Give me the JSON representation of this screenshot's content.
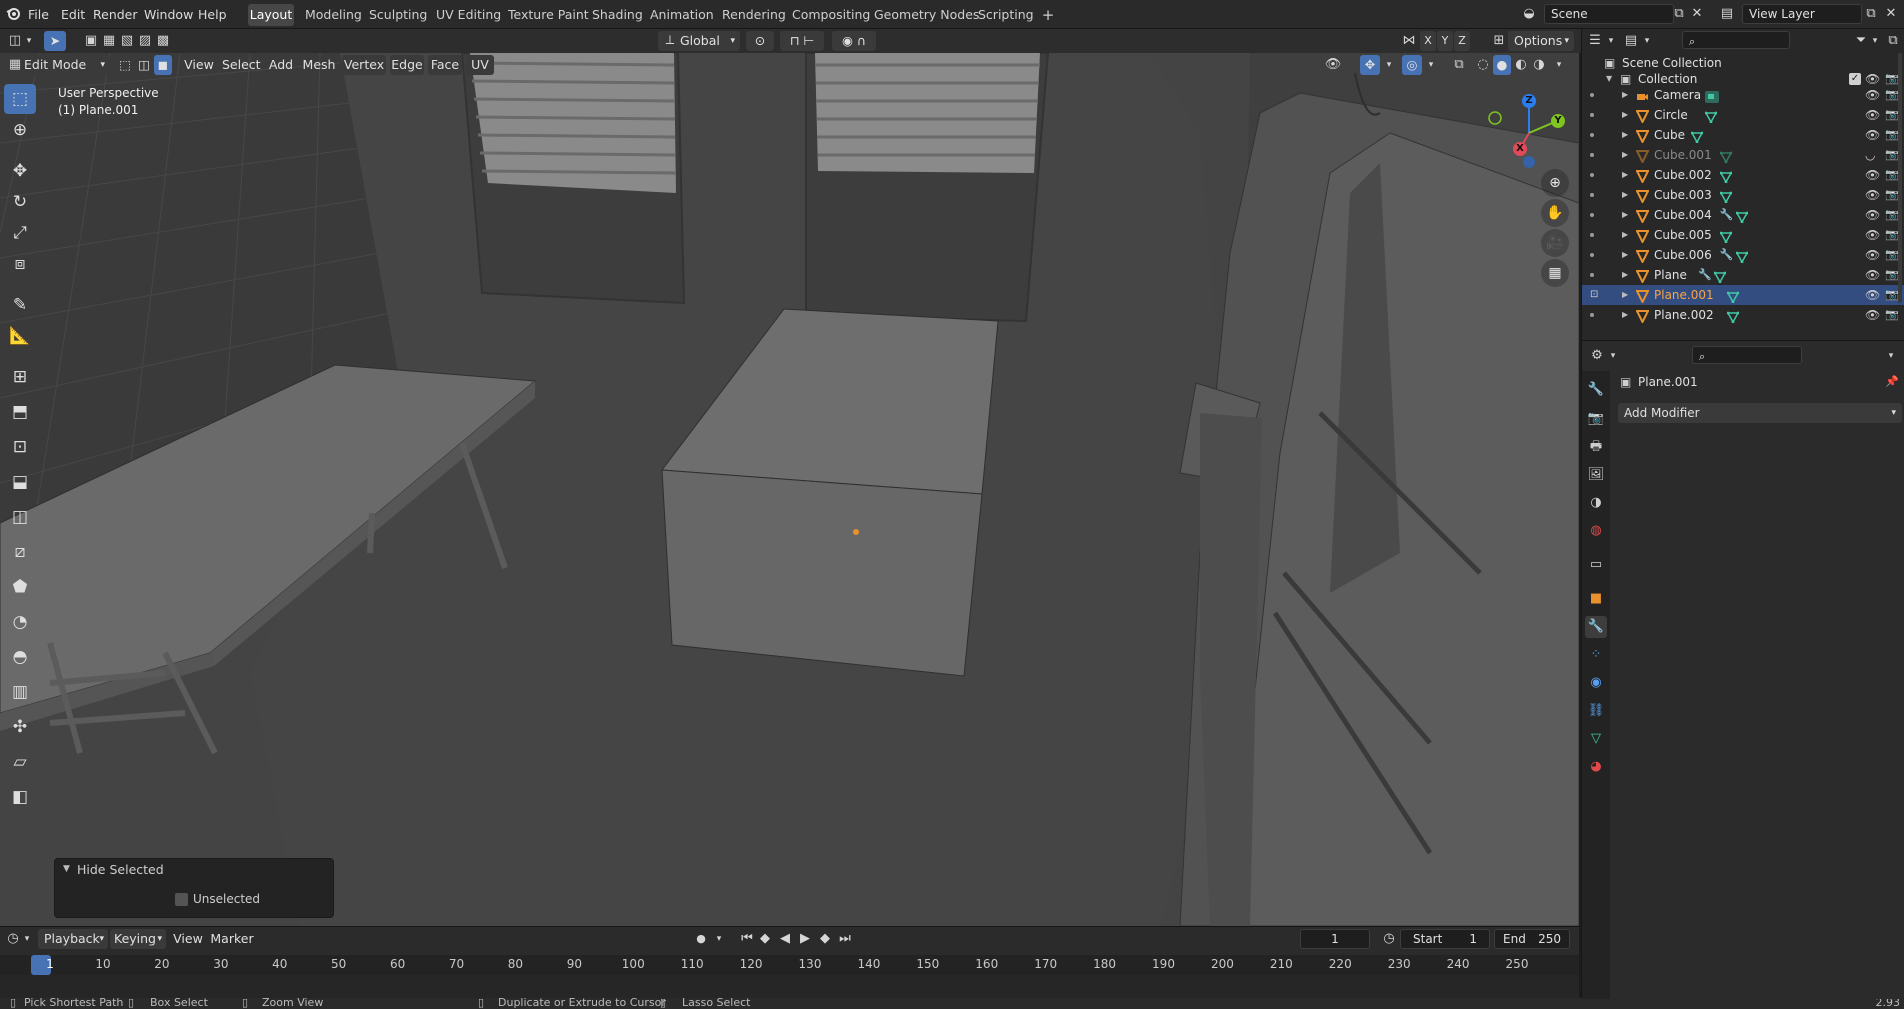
{
  "topbar": {
    "menus": [
      "File",
      "Edit",
      "Render",
      "Window",
      "Help"
    ],
    "workspaces": [
      "Layout",
      "Modeling",
      "Sculpting",
      "UV Editing",
      "Texture Paint",
      "Shading",
      "Animation",
      "Rendering",
      "Compositing",
      "Geometry Nodes",
      "Scripting"
    ],
    "active_workspace": "Layout",
    "add_tab": "+",
    "scene": "Scene",
    "view_layer": "View Layer"
  },
  "header": {
    "mode": "Edit Mode",
    "menus": [
      "View",
      "Select",
      "Add",
      "Mesh",
      "Vertex",
      "Edge",
      "Face",
      "UV"
    ],
    "transform_orientation": "Global",
    "axes": [
      "X",
      "Y",
      "Z"
    ],
    "options": "Options"
  },
  "viewport": {
    "perspective": "User Perspective",
    "object": "(1) Plane.001",
    "gizmo": {
      "x": "X",
      "y": "Y",
      "z": "Z"
    },
    "tools": [
      "select-box-icon",
      "cursor-icon",
      "move-icon",
      "rotate-icon",
      "scale-icon",
      "transform-icon",
      "annotate-icon",
      "measure-icon",
      "add-cube-icon",
      "extrude-icon",
      "inset-icon",
      "bevel-icon",
      "loop-cut-icon",
      "knife-icon",
      "poly-build-icon",
      "spin-icon",
      "smooth-icon",
      "edge-slide-icon",
      "shrink-fatten-icon",
      "shear-icon",
      "rip-icon"
    ]
  },
  "redo_panel": {
    "title": "Hide Selected",
    "checkbox_label": "Unselected",
    "checked": false
  },
  "timeline": {
    "menus": [
      "Playback",
      "Keying",
      "View",
      "Marker"
    ],
    "current_frame": "1",
    "start_label": "Start",
    "start": "1",
    "end_label": "End",
    "end": "250",
    "ruler_labels": [
      "1",
      "10",
      "20",
      "30",
      "40",
      "50",
      "60",
      "70",
      "80",
      "90",
      "100",
      "110",
      "120",
      "130",
      "140",
      "150",
      "160",
      "170",
      "180",
      "190",
      "200",
      "210",
      "220",
      "230",
      "240",
      "250"
    ]
  },
  "statusbar": {
    "items": [
      "Pick Shortest Path",
      "Box Select",
      "Zoom View",
      "Duplicate or Extrude to Cursor",
      "Lasso Select"
    ],
    "version": "2.93"
  },
  "outliner": {
    "root": "Scene Collection",
    "collection": "Collection",
    "items": [
      {
        "name": "Camera",
        "type": "camera",
        "modifier": false,
        "dim": false,
        "selected": false
      },
      {
        "name": "Circle",
        "type": "mesh",
        "modifier": false,
        "dim": false,
        "selected": false
      },
      {
        "name": "Cube",
        "type": "mesh",
        "modifier": false,
        "dim": false,
        "selected": false
      },
      {
        "name": "Cube.001",
        "type": "mesh",
        "modifier": false,
        "dim": true,
        "selected": false
      },
      {
        "name": "Cube.002",
        "type": "mesh",
        "modifier": false,
        "dim": false,
        "selected": false
      },
      {
        "name": "Cube.003",
        "type": "mesh",
        "modifier": false,
        "dim": false,
        "selected": false
      },
      {
        "name": "Cube.004",
        "type": "mesh",
        "modifier": true,
        "dim": false,
        "selected": false
      },
      {
        "name": "Cube.005",
        "type": "mesh",
        "modifier": false,
        "dim": false,
        "selected": false
      },
      {
        "name": "Cube.006",
        "type": "mesh",
        "modifier": true,
        "dim": false,
        "selected": false
      },
      {
        "name": "Plane",
        "type": "mesh",
        "modifier": true,
        "dim": false,
        "selected": false
      },
      {
        "name": "Plane.001",
        "type": "mesh",
        "modifier": false,
        "dim": false,
        "selected": true
      },
      {
        "name": "Plane.002",
        "type": "mesh",
        "modifier": false,
        "dim": false,
        "selected": false
      }
    ]
  },
  "properties": {
    "object_name": "Plane.001",
    "add_modifier": "Add Modifier",
    "tabs": [
      "tool-icon",
      "render-icon",
      "output-icon",
      "view-layer-icon",
      "scene-icon",
      "world-icon",
      "collection-icon",
      "object-icon",
      "modifier-icon",
      "particles-icon",
      "physics-icon",
      "constraints-icon",
      "data-icon",
      "material-icon"
    ],
    "active_tab": "modifier-icon"
  },
  "colors": {
    "accent": "#4772b3",
    "selected_row": "#334d80",
    "object_orange": "#e8912d",
    "mesh_green": "#3fc9a5",
    "viewport_bg": "#3d3d3d"
  }
}
